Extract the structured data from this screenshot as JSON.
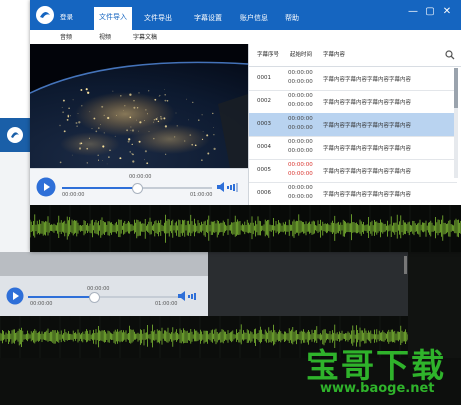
{
  "app": {
    "logo_icon": "app-logo-icon",
    "login_label": "登录",
    "brand_color": "#1565c0"
  },
  "nav": {
    "tabs": [
      {
        "label": "文件导入",
        "active": true
      },
      {
        "label": "文件导出",
        "active": false
      },
      {
        "label": "字幕设置",
        "active": false
      },
      {
        "label": "账户信息",
        "active": false
      },
      {
        "label": "帮助",
        "active": false
      }
    ]
  },
  "window_controls": {
    "minimize": "—",
    "maximize": "▢",
    "close": "✕"
  },
  "sub_nav": {
    "items": [
      "音频",
      "视频",
      "字幕文稿"
    ]
  },
  "player": {
    "current_time_top": "00:00:00",
    "elapsed": "00:00:00",
    "duration": "01:00:00",
    "progress": 0.5,
    "volume": 0.75
  },
  "subtitle_table": {
    "headers": [
      "字幕序号",
      "起始时间",
      "字幕内容"
    ],
    "rows": [
      {
        "index": "0001",
        "start": "00:00:00",
        "end": "00:00:00",
        "content": "字幕内容字幕内容字幕内容字幕内容",
        "selected": false,
        "warn": false
      },
      {
        "index": "0002",
        "start": "00:00:00",
        "end": "00:00:00",
        "content": "字幕内容字幕内容字幕内容字幕内容",
        "selected": false,
        "warn": false
      },
      {
        "index": "0003",
        "start": "00:00:00",
        "end": "00:00:00",
        "content": "字幕内容字幕内容字幕内容字幕内容",
        "selected": true,
        "warn": false
      },
      {
        "index": "0004",
        "start": "00:00:00",
        "end": "00:00:00",
        "content": "字幕内容字幕内容字幕内容字幕内容",
        "selected": false,
        "warn": false
      },
      {
        "index": "0005",
        "start": "00:00:00",
        "end": "00:00:00",
        "content": "字幕内容字幕内容字幕内容字幕内容",
        "selected": false,
        "warn": true
      },
      {
        "index": "0006",
        "start": "00:00:00",
        "end": "00:00:00",
        "content": "字幕内容字幕内容字幕内容字幕内容",
        "selected": false,
        "warn": false
      }
    ]
  },
  "background_player": {
    "elapsed": "00:00:00",
    "duration": "01:00:00",
    "current_time_top": "00:00:00"
  },
  "watermark": {
    "title": "宝哥下载",
    "url": "www.baoge.net",
    "color": "#2fb32b"
  }
}
